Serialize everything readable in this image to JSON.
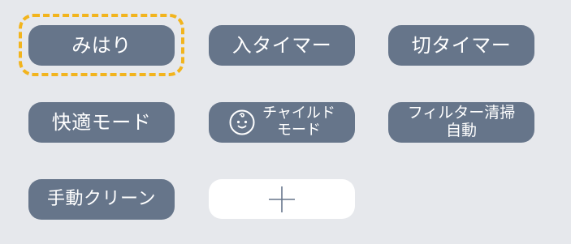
{
  "buttons": {
    "mihari": "みはり",
    "on_timer": "入タイマー",
    "off_timer": "切タイマー",
    "comfort_mode": "快適モード",
    "child_mode_line1": "チャイルド",
    "child_mode_line2": "モード",
    "filter_clean_line1": "フィルター清掃",
    "filter_clean_line2": "自動",
    "manual_clean": "手動クリーン"
  },
  "selected": "mihari",
  "colors": {
    "background": "#e6e8ec",
    "button": "#66758a",
    "button_text": "#ffffff",
    "selection_ring": "#f2b41d",
    "add_button": "#ffffff"
  },
  "icons": {
    "child": "baby-face-icon",
    "add": "plus-icon"
  }
}
